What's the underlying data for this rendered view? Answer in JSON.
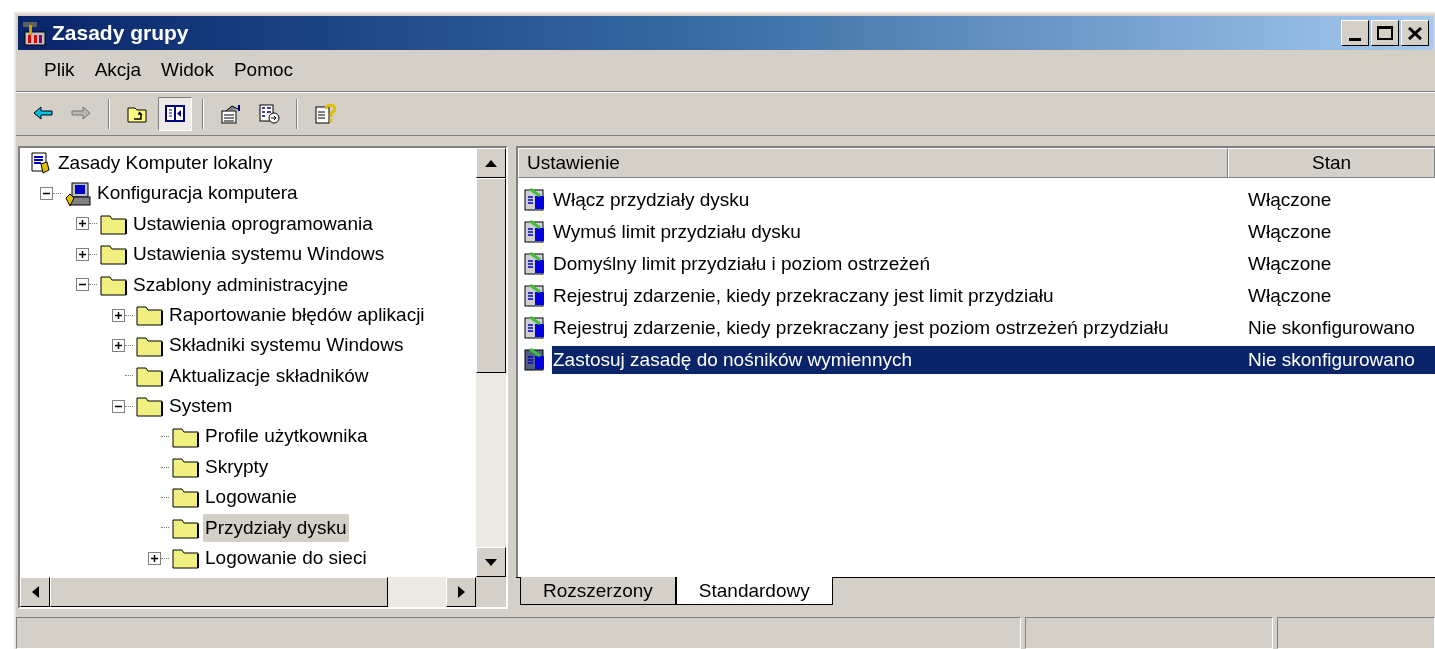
{
  "window": {
    "title": "Zasady grupy"
  },
  "menu": [
    "Plik",
    "Akcja",
    "Widok",
    "Pomoc"
  ],
  "toolbar": [
    {
      "kind": "back",
      "disabled": false,
      "pressed": false
    },
    {
      "kind": "forward",
      "disabled": true,
      "pressed": false
    },
    {
      "kind": "separator"
    },
    {
      "kind": "up",
      "disabled": false,
      "pressed": false
    },
    {
      "kind": "tree",
      "disabled": false,
      "pressed": true
    },
    {
      "kind": "separator"
    },
    {
      "kind": "properties",
      "disabled": false,
      "pressed": false
    },
    {
      "kind": "export",
      "disabled": false,
      "pressed": false
    },
    {
      "kind": "separator"
    },
    {
      "kind": "help",
      "disabled": false,
      "pressed": false
    }
  ],
  "tree": [
    {
      "label": "Zasady Komputer lokalny",
      "kind": "policy",
      "selected": false,
      "children": [
        {
          "label": "Konfiguracja komputera",
          "kind": "computer",
          "selected": false,
          "expanded": true,
          "children": [
            {
              "label": "Ustawienia oprogramowania",
              "kind": "folder",
              "selected": false,
              "expanded": false
            },
            {
              "label": "Ustawienia systemu Windows",
              "kind": "folder",
              "selected": false,
              "expanded": false
            },
            {
              "label": "Szablony administracyjne",
              "kind": "folder",
              "selected": false,
              "expanded": true,
              "children": [
                {
                  "label": "Raportowanie błędów aplikacji",
                  "kind": "folder",
                  "selected": false,
                  "expanded": false
                },
                {
                  "label": "Składniki systemu Windows",
                  "kind": "folder",
                  "selected": false,
                  "expanded": false
                },
                {
                  "label": "Aktualizacje składników",
                  "kind": "folder",
                  "selected": false
                },
                {
                  "label": "System",
                  "kind": "folder",
                  "selected": false,
                  "expanded": true,
                  "children": [
                    {
                      "label": "Profile użytkownika",
                      "kind": "folder",
                      "selected": false
                    },
                    {
                      "label": "Skrypty",
                      "kind": "folder",
                      "selected": false
                    },
                    {
                      "label": "Logowanie",
                      "kind": "folder",
                      "selected": false
                    },
                    {
                      "label": "Przydziały dysku",
                      "kind": "folder",
                      "selected": true
                    },
                    {
                      "label": "Logowanie do sieci",
                      "kind": "folder",
                      "selected": false,
                      "expanded": false
                    }
                  ]
                }
              ]
            }
          ]
        }
      ]
    }
  ],
  "list": {
    "columns": [
      "Ustawienie",
      "Stan"
    ],
    "rows": [
      {
        "setting": "Włącz przydziały dysku",
        "state": "Włączone",
        "selected": false
      },
      {
        "setting": "Wymuś limit przydziału dysku",
        "state": "Włączone",
        "selected": false
      },
      {
        "setting": "Domyślny limit przydziału i poziom ostrzeżeń",
        "state": "Włączone",
        "selected": false
      },
      {
        "setting": "Rejestruj zdarzenie, kiedy przekraczany jest limit przydziału",
        "state": "Włączone",
        "selected": false
      },
      {
        "setting": "Rejestruj zdarzenie, kiedy przekraczany jest poziom ostrzeżeń przydziału",
        "state": "Nie skonfigurowano",
        "selected": false
      },
      {
        "setting": "Zastosuj zasadę do nośników wymiennych",
        "state": "Nie skonfigurowano",
        "selected": true
      }
    ]
  },
  "view_tabs": [
    {
      "label": "Rozszerzony",
      "selected": false
    },
    {
      "label": "Standardowy",
      "selected": true
    }
  ]
}
